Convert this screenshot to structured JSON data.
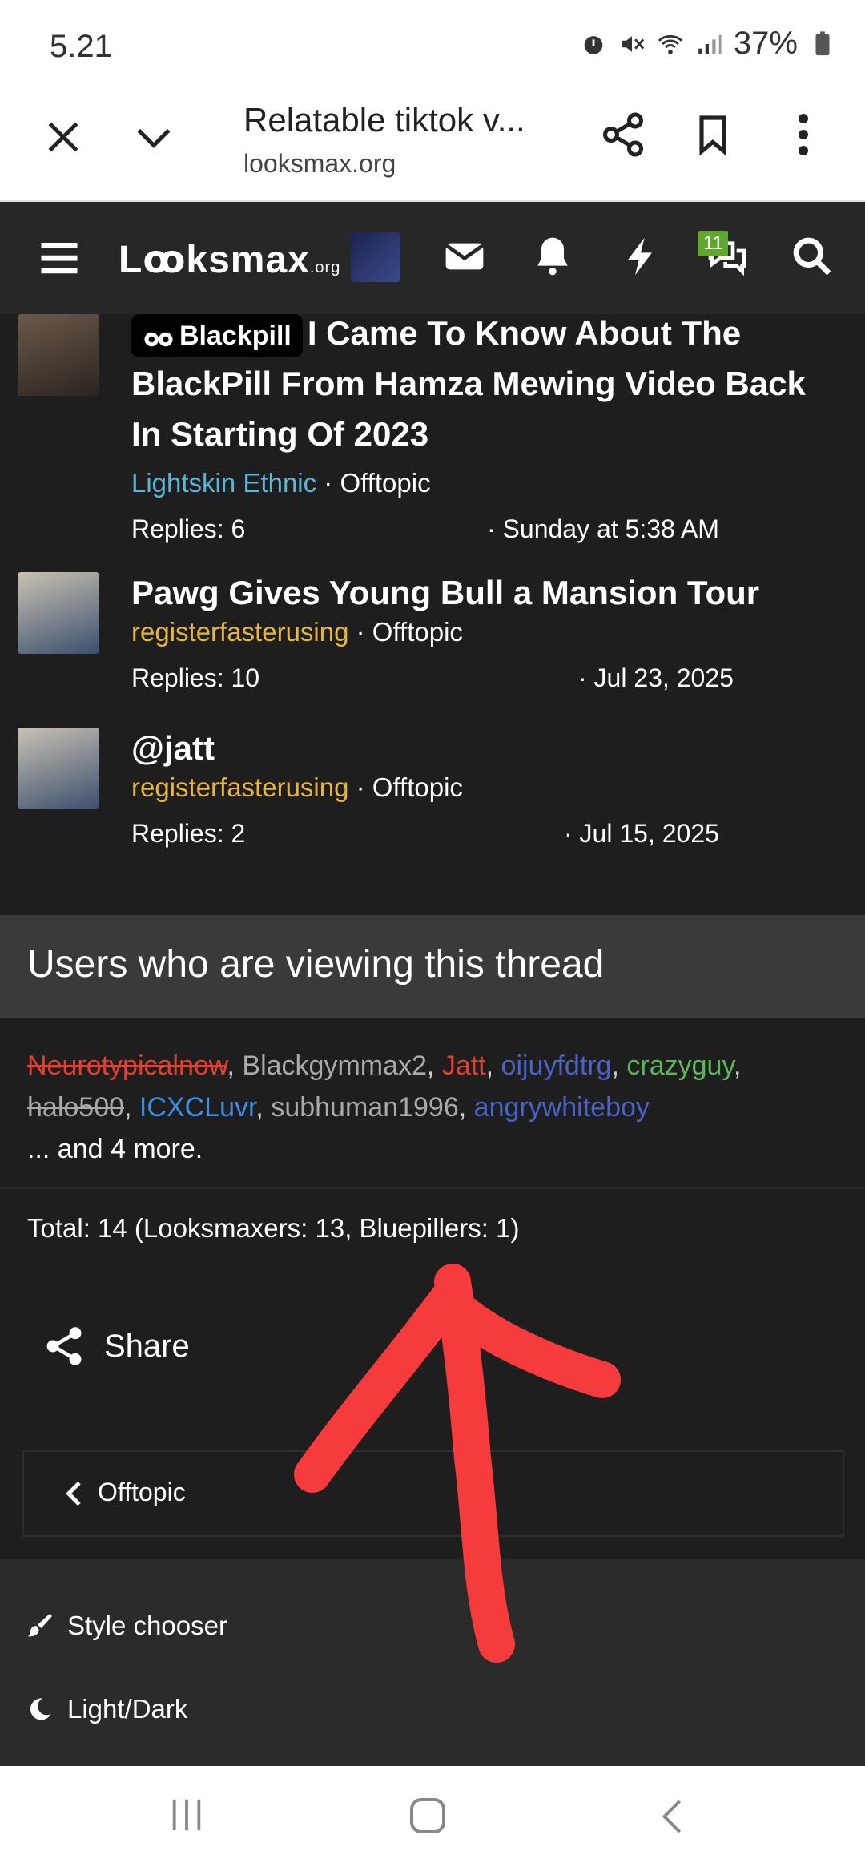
{
  "status_bar": {
    "time": "5.21",
    "battery": "37%"
  },
  "browser": {
    "title": "Relatable tiktok v...",
    "domain": "looksmax.org"
  },
  "site": {
    "logo": "Lꝏksmax",
    "logo_suffix": ".org",
    "message_badge": "11"
  },
  "threads": [
    {
      "tag": "Blackpill",
      "title": "I Came To Know About The BlackPill From Hamza Mewing Video Back In Starting Of 2023",
      "author": "Lightskin Ethnic",
      "forum": "Offtopic",
      "replies": "Replies: 6",
      "date": "Sunday at 5:38 AM"
    },
    {
      "title": "Pawg Gives Young Bull a Mansion Tour",
      "author": "registerfasterusing",
      "forum": "Offtopic",
      "replies": "Replies: 10",
      "date": "Jul 23, 2025"
    },
    {
      "title": "@jatt",
      "author": "registerfasterusing",
      "forum": "Offtopic",
      "replies": "Replies: 2",
      "date": "Jul 15, 2025"
    }
  ],
  "viewers": {
    "heading": "Users who are viewing this thread",
    "users": [
      "Neurotypicalnow",
      "Blackgymmax2",
      "Jatt",
      "oijuyfdtrg",
      "crazyguy",
      "halo500",
      "ICXCLuvr",
      "subhuman1996",
      "angrywhiteboy"
    ],
    "more": "... and 4 more.",
    "total": "Total: 14 (Looksmaxers: 13, Bluepillers: 1)"
  },
  "share_label": "Share",
  "breadcrumb": "Offtopic",
  "footer": {
    "style_chooser": "Style chooser",
    "light_dark": "Light/Dark"
  },
  "colors": {
    "accent_gold": "#e6b53a",
    "accent_red": "#e0402f",
    "annotation_arrow": "#f53b3b"
  }
}
